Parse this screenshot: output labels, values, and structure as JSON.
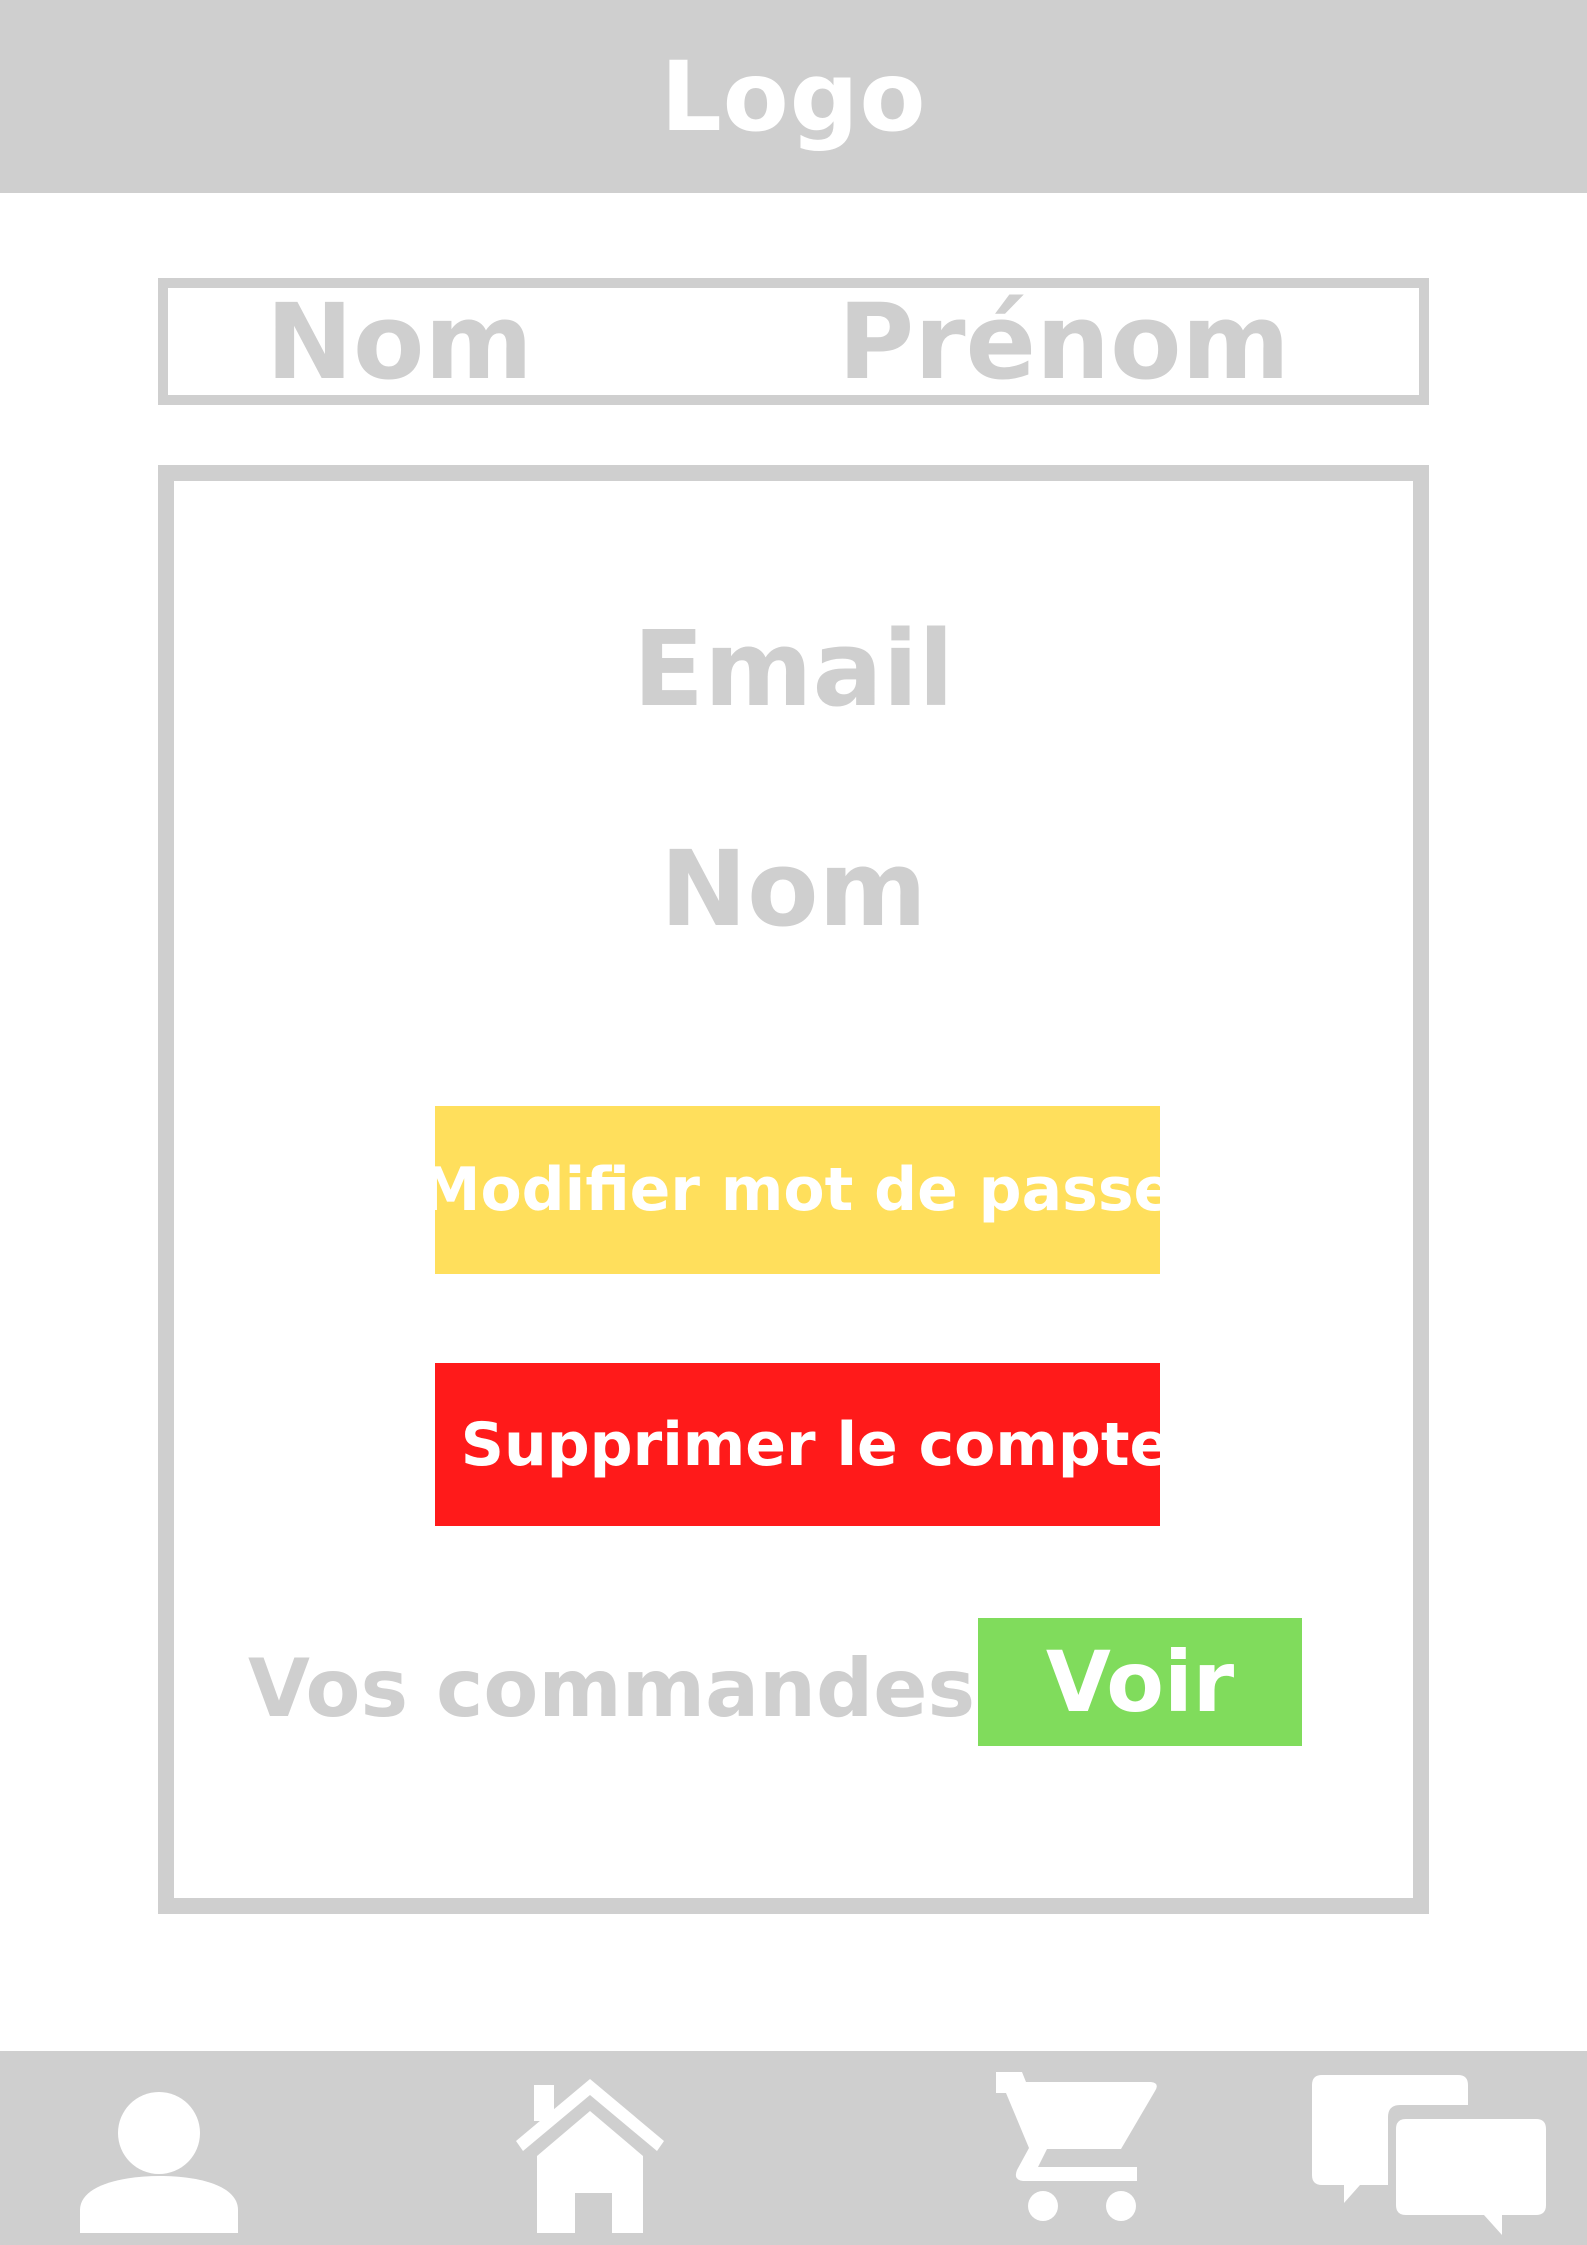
{
  "header": {
    "logo_text": "Logo"
  },
  "profile": {
    "last_name_label": "Nom",
    "first_name_label": "Prénom"
  },
  "account": {
    "email_label": "Email",
    "name_label": "Nom",
    "change_password_label": "Modifier mot de passe",
    "delete_account_label": "Supprimer le compte",
    "orders_label": "Vos commandes",
    "view_orders_label": "Voir"
  },
  "colors": {
    "frame_gray": "#cfcfcf",
    "password_button": "#ffdf5c",
    "delete_button": "#ff1a1a",
    "view_button": "#80dc5c",
    "text_on_button": "#ffffff"
  },
  "bottom_nav": {
    "items": [
      {
        "icon": "user-icon"
      },
      {
        "icon": "home-icon"
      },
      {
        "icon": "cart-icon"
      },
      {
        "icon": "chat-icon"
      }
    ]
  }
}
